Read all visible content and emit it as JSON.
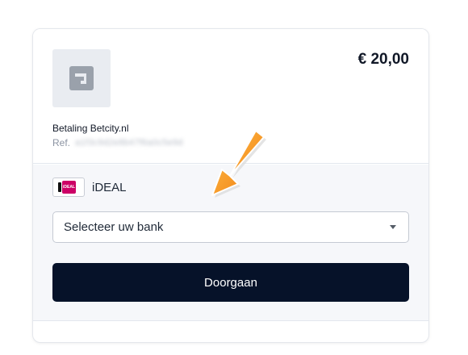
{
  "payment": {
    "amount": "€ 20,00",
    "merchant": "Betaling Betcity.nl",
    "ref_label": "Ref.",
    "ref_value": "a1f3c9d2e8b47f6a0c5e9d"
  },
  "method": {
    "icon": "ideal-logo-icon",
    "badge_text": "iDEAL",
    "label": "iDEAL"
  },
  "bank_select": {
    "selected": "Selecteer uw bank"
  },
  "actions": {
    "continue_label": "Doorgaan"
  },
  "colors": {
    "button": "#061229",
    "ideal_brand": "#cc0066",
    "arrow": "#f7931e"
  }
}
